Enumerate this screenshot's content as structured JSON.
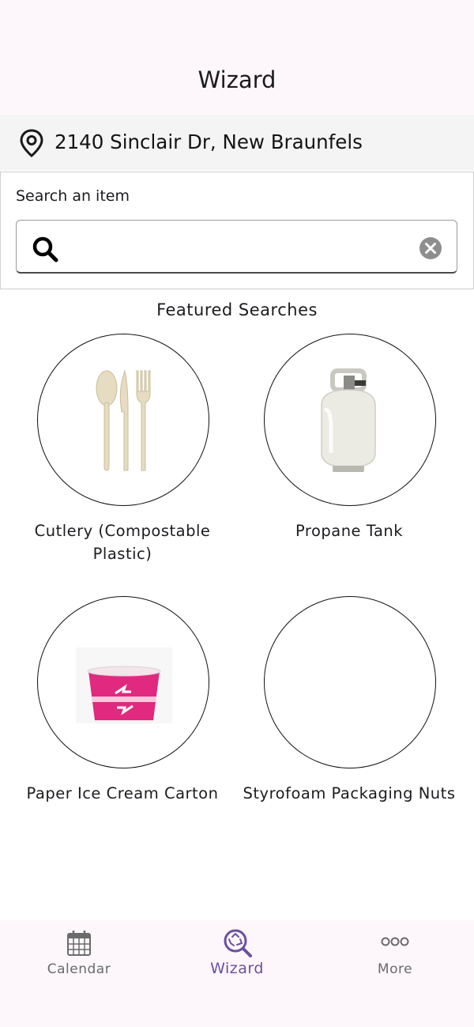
{
  "header": {
    "title": "Wizard"
  },
  "location": {
    "address": "2140 Sinclair Dr, New Braunfels",
    "icon": "map-pin-icon"
  },
  "search": {
    "label": "Search an item",
    "value": "",
    "placeholder": ""
  },
  "featured": {
    "title": "Featured Searches",
    "items": [
      {
        "label": "Cutlery (Compostable Plastic)",
        "image": "compostable-cutlery"
      },
      {
        "label": "Propane Tank",
        "image": "propane-tank"
      },
      {
        "label": "Paper Ice Cream Carton",
        "image": "pink-paper-cup"
      },
      {
        "label": "Styrofoam Packaging Nuts",
        "image": ""
      }
    ]
  },
  "nav": {
    "items": [
      {
        "label": "Calendar",
        "icon": "calendar-icon",
        "active": false
      },
      {
        "label": "Wizard",
        "icon": "recycle-search-icon",
        "active": true
      },
      {
        "label": "More",
        "icon": "more-dots-icon",
        "active": false
      }
    ]
  },
  "colors": {
    "accent": "#6b4fa0",
    "header_bg": "#fdf7fb",
    "address_bg": "#f4f4f4",
    "cup_pink": "#e0297f"
  }
}
